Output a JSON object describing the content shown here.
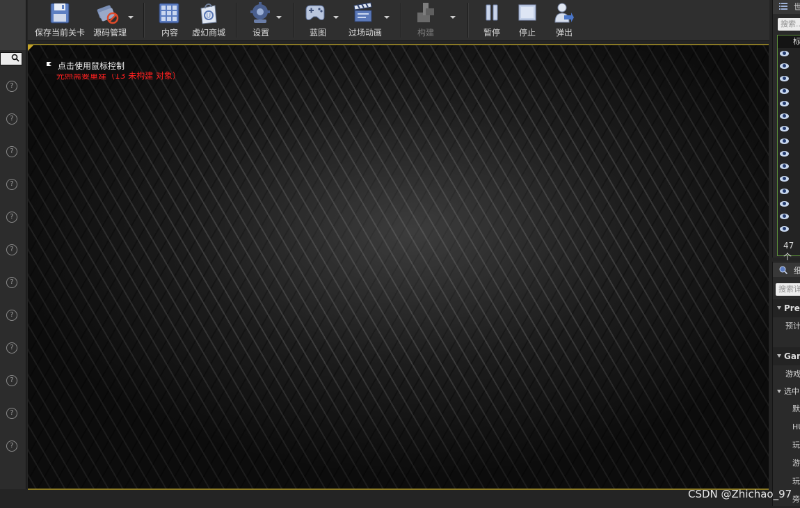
{
  "toolbar": {
    "save_label": "保存当前关卡",
    "source_control_label": "源码管理",
    "content_label": "内容",
    "marketplace_label": "虚幻商城",
    "settings_label": "设置",
    "blueprints_label": "蓝图",
    "cinematics_label": "过场动画",
    "build_label": "构建",
    "pause_label": "暂停",
    "stop_label": "停止",
    "eject_label": "弹出"
  },
  "viewport": {
    "mouse_hint": "点击使用鼠标控制",
    "lighting_warning": "光照需要重建（13 未构建 对象）"
  },
  "outliner": {
    "title": "世",
    "search_placeholder": "搜索...",
    "header_label": "标",
    "count": "47个"
  },
  "details": {
    "title": "细",
    "search_placeholder": "搜索详",
    "categories": [
      {
        "label": "Prec"
      },
      {
        "label": "Gam"
      }
    ],
    "rows": {
      "predict": "预计",
      "game": "游戏",
      "selected": "选中",
      "default": "默",
      "hud": "HU",
      "player1": "玩",
      "game2": "游",
      "player2": "玩",
      "spectator": "旁"
    }
  },
  "watermark": "CSDN @Zhichao_97",
  "colors": {
    "accent_border": "#8b7a25",
    "warning_text": "#ff2020",
    "outliner_border": "#5c8e3a"
  }
}
